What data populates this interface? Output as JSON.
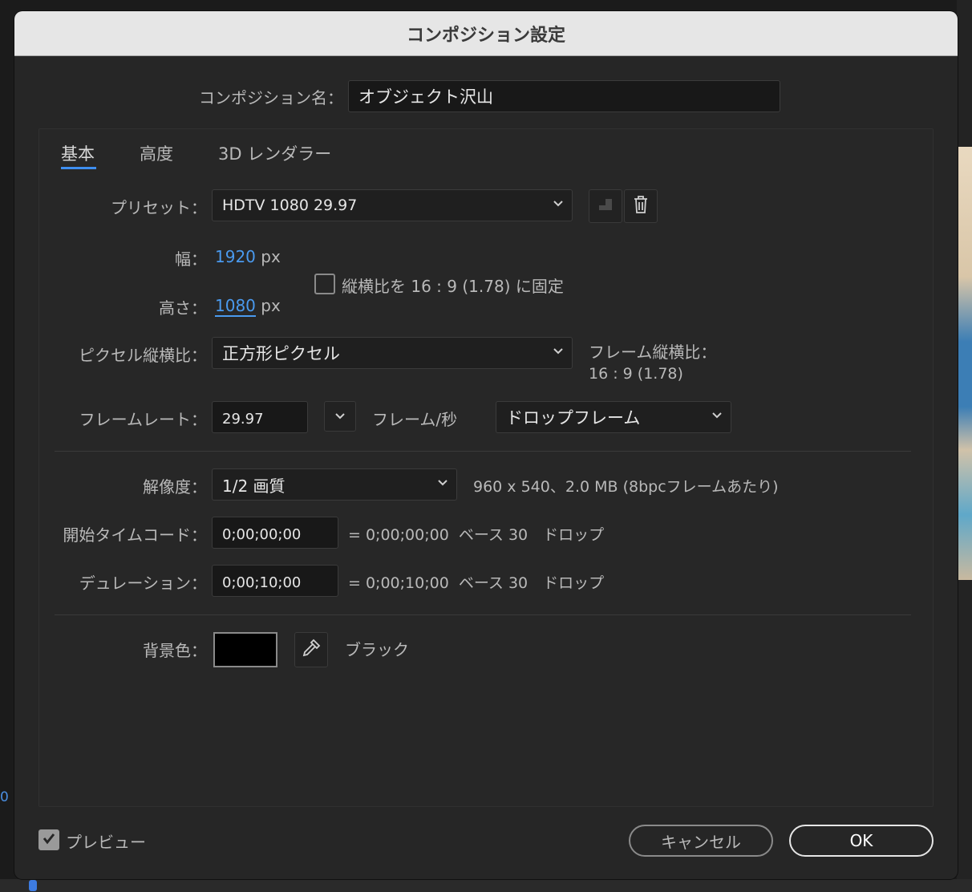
{
  "dialog": {
    "title": "コンポジション設定"
  },
  "comp_name": {
    "label": "コンポジション名：",
    "value": "オブジェクト沢山"
  },
  "tabs": [
    {
      "label": "基本",
      "active": true
    },
    {
      "label": "高度",
      "active": false
    },
    {
      "label": "3D レンダラー",
      "active": false
    }
  ],
  "preset": {
    "label": "プリセット：",
    "value": "HDTV 1080 29.97"
  },
  "width": {
    "label": "幅：",
    "value": "1920",
    "unit": "px"
  },
  "height": {
    "label": "高さ：",
    "value": "1080",
    "unit": "px"
  },
  "lock_aspect": {
    "label": "縦横比を 16 : 9 (1.78) に固定",
    "checked": false
  },
  "pixel_aspect": {
    "label": "ピクセル縦横比：",
    "value": "正方形ピクセル"
  },
  "frame_aspect": {
    "label": "フレーム縦横比：",
    "value": "16 : 9 (1.78)"
  },
  "frame_rate": {
    "label": "フレームレート：",
    "value": "29.97",
    "unit": "フレーム/秒",
    "mode": "ドロップフレーム"
  },
  "resolution": {
    "label": "解像度：",
    "value": "1/2 画質",
    "info": "960 x 540、2.0 MB (8bpcフレームあたり)"
  },
  "start_timecode": {
    "label": "開始タイムコード：",
    "value": "0;00;00;00",
    "info": "= 0;00;00;00  ベース 30　ドロップ"
  },
  "duration": {
    "label": "デュレーション：",
    "value": "0;00;10;00",
    "info": "= 0;00;10;00  ベース 30　ドロップ"
  },
  "background": {
    "label": "背景色：",
    "color_name": "ブラック",
    "color": "#000000"
  },
  "footer": {
    "preview_label": "プレビュー",
    "preview_checked": true,
    "cancel_label": "キャンセル",
    "ok_label": "OK"
  },
  "background_app": {
    "timeline_value": "0"
  },
  "colors": {
    "accent": "#3e8ef0",
    "link_value": "#4a9aef"
  }
}
